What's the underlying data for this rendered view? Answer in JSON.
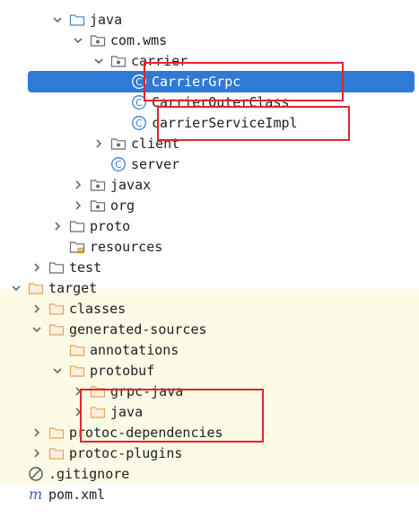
{
  "tree": [
    {
      "label": "java",
      "depth": 4,
      "arrow": "down",
      "icon": "folder-icon",
      "color": "blue"
    },
    {
      "label": "com.wms",
      "depth": 5,
      "arrow": "down",
      "icon": "package-icon"
    },
    {
      "label": "carrier",
      "depth": 6,
      "arrow": "down",
      "icon": "package-icon"
    },
    {
      "label": "CarrierGrpc",
      "depth": 7,
      "arrow": "none",
      "icon": "class-icon",
      "selected": true
    },
    {
      "label": "CarrierOuterClass",
      "depth": 7,
      "arrow": "none",
      "icon": "class-icon"
    },
    {
      "label": "carrierServiceImpl",
      "depth": 7,
      "arrow": "none",
      "icon": "class-icon"
    },
    {
      "label": "client",
      "depth": 6,
      "arrow": "right",
      "icon": "package-icon"
    },
    {
      "label": "server",
      "depth": 6,
      "arrow": "none",
      "icon": "class-icon"
    },
    {
      "label": "javax",
      "depth": 5,
      "arrow": "right",
      "icon": "package-icon"
    },
    {
      "label": "org",
      "depth": 5,
      "arrow": "right",
      "icon": "package-icon"
    },
    {
      "label": "proto",
      "depth": 4,
      "arrow": "right",
      "icon": "folder-icon"
    },
    {
      "label": "resources",
      "depth": 4,
      "arrow": "none",
      "icon": "resources-folder-icon"
    },
    {
      "label": "test",
      "depth": 3,
      "arrow": "right",
      "icon": "folder-icon"
    },
    {
      "label": "target",
      "depth": 2,
      "arrow": "down",
      "icon": "folder-icon",
      "color": "orange"
    },
    {
      "label": "classes",
      "depth": 3,
      "arrow": "right",
      "icon": "folder-icon",
      "color": "orange"
    },
    {
      "label": "generated-sources",
      "depth": 3,
      "arrow": "down",
      "icon": "folder-icon",
      "color": "orange"
    },
    {
      "label": "annotations",
      "depth": 4,
      "arrow": "none",
      "icon": "folder-icon",
      "color": "orange"
    },
    {
      "label": "protobuf",
      "depth": 4,
      "arrow": "down",
      "icon": "folder-icon",
      "color": "orange"
    },
    {
      "label": "grpc-java",
      "depth": 5,
      "arrow": "right",
      "icon": "folder-icon",
      "color": "orange"
    },
    {
      "label": "java",
      "depth": 5,
      "arrow": "right",
      "icon": "folder-icon",
      "color": "orange"
    },
    {
      "label": "protoc-dependencies",
      "depth": 3,
      "arrow": "right",
      "icon": "folder-icon",
      "color": "orange"
    },
    {
      "label": "protoc-plugins",
      "depth": 3,
      "arrow": "right",
      "icon": "folder-icon",
      "color": "orange"
    },
    {
      "label": ".gitignore",
      "depth": 2,
      "arrow": "none",
      "icon": "gitignore-icon"
    },
    {
      "label": "pom.xml",
      "depth": 2,
      "arrow": "none",
      "icon": "maven-icon"
    }
  ],
  "colors": {
    "selection": "#2f7ad6",
    "highlight_border": "#e0262c",
    "excluded_bg": "#fcfbe6",
    "folder_blue": "#4f7fc6",
    "folder_orange": "#e8a257",
    "class_icon": "#3f7fd4"
  }
}
